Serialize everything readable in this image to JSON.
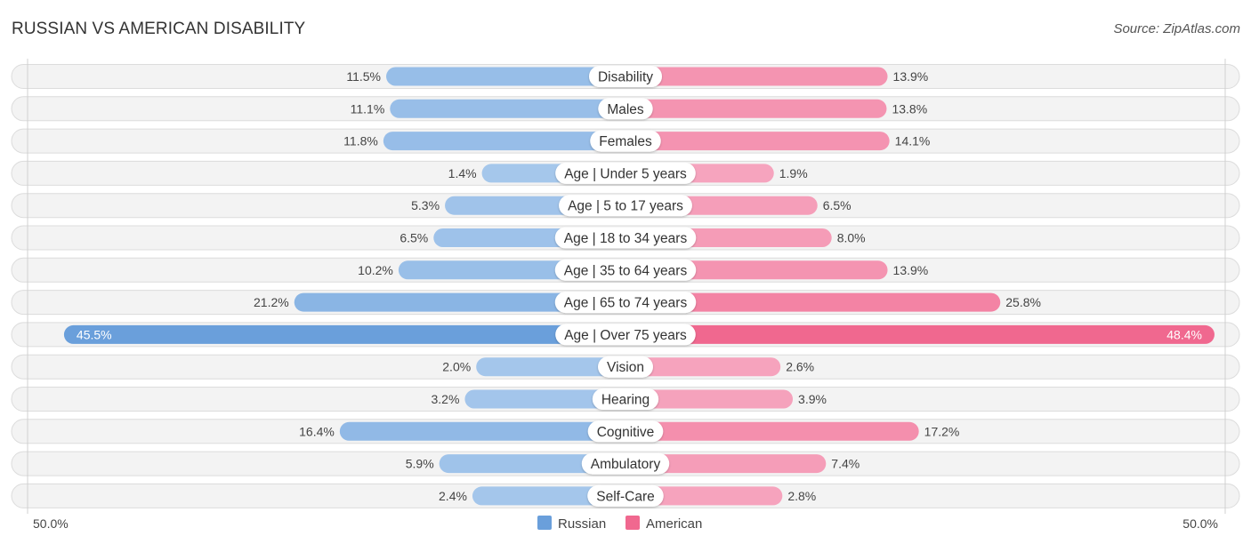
{
  "header": {
    "title": "RUSSIAN VS AMERICAN DISABILITY",
    "source": "Source: ZipAtlas.com"
  },
  "colors": {
    "russian": "#6a9fdb",
    "russian_light": "#a7c8ec",
    "american": "#f0688f",
    "american_light": "#f6a7c0"
  },
  "chart_data": {
    "type": "bar",
    "orientation": "horizontal-diverging",
    "title": "RUSSIAN VS AMERICAN DISABILITY",
    "categories": [
      "Disability",
      "Males",
      "Females",
      "Age | Under 5 years",
      "Age | 5 to 17 years",
      "Age | 18 to 34 years",
      "Age | 35 to 64 years",
      "Age | 65 to 74 years",
      "Age | Over 75 years",
      "Vision",
      "Hearing",
      "Cognitive",
      "Ambulatory",
      "Self-Care"
    ],
    "series": [
      {
        "name": "Russian",
        "side": "left",
        "values": [
          11.5,
          11.1,
          11.8,
          1.4,
          5.3,
          6.5,
          10.2,
          21.2,
          45.5,
          2.0,
          3.2,
          16.4,
          5.9,
          2.4
        ]
      },
      {
        "name": "American",
        "side": "right",
        "values": [
          13.9,
          13.8,
          14.1,
          1.9,
          6.5,
          8.0,
          13.9,
          25.8,
          48.4,
          2.6,
          3.9,
          17.2,
          7.4,
          2.8
        ]
      }
    ],
    "value_labels": {
      "Russian": [
        "11.5%",
        "11.1%",
        "11.8%",
        "1.4%",
        "5.3%",
        "6.5%",
        "10.2%",
        "21.2%",
        "45.5%",
        "2.0%",
        "3.2%",
        "16.4%",
        "5.9%",
        "2.4%"
      ],
      "American": [
        "13.9%",
        "13.8%",
        "14.1%",
        "1.9%",
        "6.5%",
        "8.0%",
        "13.9%",
        "25.8%",
        "48.4%",
        "2.6%",
        "3.9%",
        "17.2%",
        "7.4%",
        "2.8%"
      ]
    },
    "axis": {
      "left_label": "50.0%",
      "right_label": "50.0%",
      "range": [
        0,
        50
      ]
    },
    "legend": {
      "position": "bottom-center",
      "items": [
        "Russian",
        "American"
      ]
    },
    "xlabel": "",
    "ylabel": ""
  }
}
